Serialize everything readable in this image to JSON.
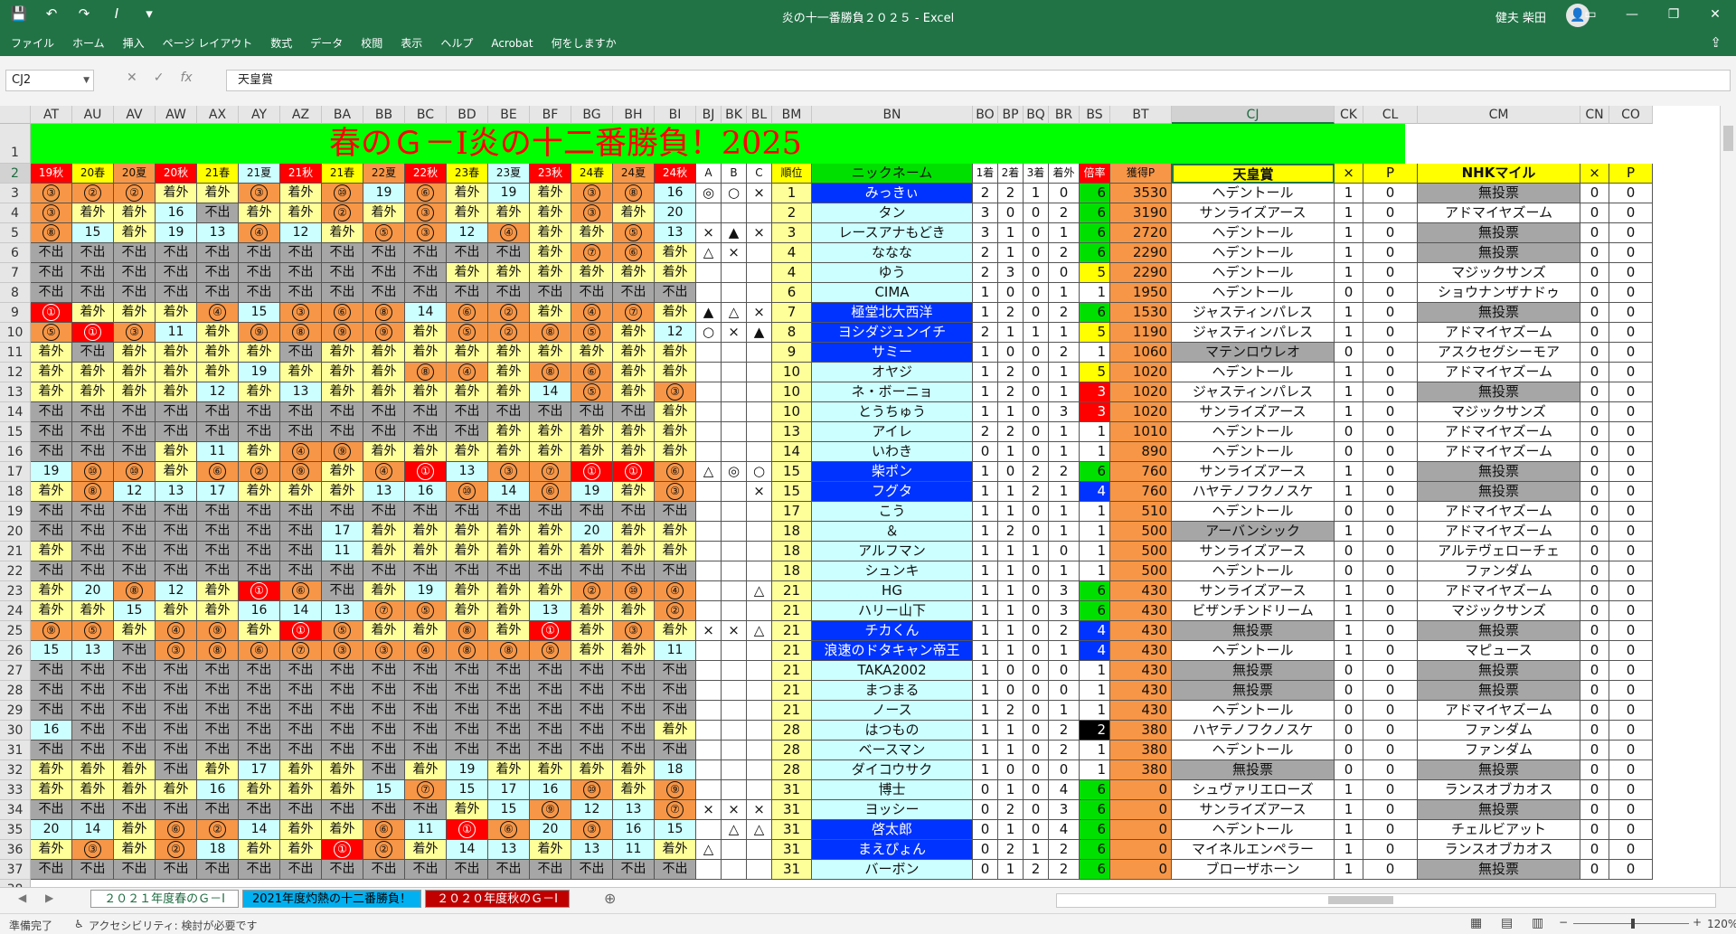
{
  "window": {
    "title": "炎の十一番勝負２０２５ - Excel",
    "user": "健夫 柴田",
    "qat": [
      "save-icon",
      "undo-icon",
      "redo-icon",
      "italic-icon",
      "customize-icon"
    ]
  },
  "ribbon": {
    "tabs": [
      "ファイル",
      "ホーム",
      "挿入",
      "ページ レイアウト",
      "数式",
      "データ",
      "校閲",
      "表示",
      "ヘルプ",
      "Acrobat",
      "何をしますか"
    ]
  },
  "formula_bar": {
    "name_box": "CJ2",
    "fx_label": "fx",
    "content": "天皇賞"
  },
  "sheet": {
    "title": "春のＧ－Ⅰ炎の十二番勝負！2025",
    "columns": [
      "AT",
      "AU",
      "AV",
      "AW",
      "AX",
      "AY",
      "AZ",
      "BA",
      "BB",
      "BC",
      "BD",
      "BE",
      "BF",
      "BG",
      "BH",
      "BI",
      "BJ",
      "BK",
      "BL",
      "BM",
      "BN",
      "BO",
      "BP",
      "BQ",
      "BR",
      "BS",
      "BT",
      "CJ",
      "CK",
      "CL",
      "CM",
      "CN",
      "CO"
    ],
    "row_numbers": [
      "1",
      "2",
      "3",
      "4",
      "5",
      "6",
      "7",
      "8",
      "9",
      "10",
      "11",
      "12",
      "13",
      "14",
      "15",
      "16",
      "17",
      "18",
      "19",
      "20",
      "21",
      "22",
      "23",
      "24",
      "25",
      "26",
      "27",
      "28",
      "29",
      "30",
      "31",
      "32",
      "33",
      "34",
      "35",
      "36",
      "37",
      "38"
    ],
    "header_row": [
      "19秋",
      "20春",
      "20夏",
      "20秋",
      "21春",
      "21夏",
      "21秋",
      "21春",
      "22夏",
      "22秋",
      "23春",
      "23夏",
      "23秋",
      "24春",
      "24夏",
      "24秋",
      "A",
      "B",
      "C",
      "順位",
      "ニックネーム",
      "1着",
      "2着",
      "3着",
      "着外",
      "倍率",
      "獲得P",
      "天皇賞",
      "×",
      "P",
      "NHKマイル",
      "×",
      "P"
    ],
    "rows": [
      [
        "③",
        "②",
        "②",
        "着外",
        "着外",
        "③",
        "着外",
        "⑩",
        "19",
        "⑥",
        "着外",
        "19",
        "着外",
        "③",
        "⑧",
        "16",
        "◎",
        "○",
        "×",
        "1",
        "みっきぃ",
        "2",
        "2",
        "1",
        "0",
        "6",
        "3530",
        "ヘデントール",
        "1",
        "0",
        "無投票",
        "0",
        "0"
      ],
      [
        "③",
        "着外",
        "着外",
        "16",
        "不出",
        "着外",
        "着外",
        "②",
        "着外",
        "③",
        "着外",
        "着外",
        "着外",
        "③",
        "着外",
        "20",
        "",
        "",
        "",
        "2",
        "タン",
        "3",
        "0",
        "0",
        "2",
        "6",
        "3190",
        "サンライズアース",
        "1",
        "0",
        "アドマイヤズーム",
        "0",
        "0"
      ],
      [
        "⑧",
        "15",
        "着外",
        "19",
        "13",
        "④",
        "12",
        "着外",
        "⑤",
        "③",
        "12",
        "④",
        "着外",
        "着外",
        "⑤",
        "13",
        "×",
        "▲",
        "×",
        "3",
        "レースアナもどき",
        "3",
        "1",
        "0",
        "1",
        "6",
        "2720",
        "ヘデントール",
        "1",
        "0",
        "無投票",
        "0",
        "0"
      ],
      [
        "不出",
        "不出",
        "不出",
        "不出",
        "不出",
        "不出",
        "不出",
        "不出",
        "不出",
        "不出",
        "不出",
        "不出",
        "着外",
        "⑦",
        "⑥",
        "着外",
        "△",
        "×",
        "",
        "4",
        "ななな",
        "2",
        "1",
        "0",
        "2",
        "6",
        "2290",
        "ヘデントール",
        "1",
        "0",
        "無投票",
        "0",
        "0"
      ],
      [
        "不出",
        "不出",
        "不出",
        "不出",
        "不出",
        "不出",
        "不出",
        "不出",
        "不出",
        "不出",
        "着外",
        "着外",
        "着外",
        "着外",
        "着外",
        "着外",
        "",
        "",
        "",
        "4",
        "ゆう",
        "2",
        "3",
        "0",
        "0",
        "5",
        "2290",
        "ヘデントール",
        "1",
        "0",
        "マジックサンズ",
        "0",
        "0"
      ],
      [
        "不出",
        "不出",
        "不出",
        "不出",
        "不出",
        "不出",
        "不出",
        "不出",
        "不出",
        "不出",
        "不出",
        "不出",
        "不出",
        "不出",
        "不出",
        "不出",
        "",
        "",
        "",
        "6",
        "CIMA",
        "1",
        "0",
        "0",
        "1",
        "1",
        "1950",
        "ヘデントール",
        "0",
        "0",
        "ショウナンザナドゥ",
        "0",
        "0"
      ],
      [
        "①",
        "着外",
        "着外",
        "着外",
        "④",
        "15",
        "③",
        "⑥",
        "⑧",
        "14",
        "⑥",
        "②",
        "着外",
        "④",
        "⑦",
        "着外",
        "▲",
        "△",
        "×",
        "7",
        "極堂北大西洋",
        "1",
        "2",
        "0",
        "2",
        "6",
        "1530",
        "ジャスティンパレス",
        "1",
        "0",
        "無投票",
        "0",
        "0"
      ],
      [
        "⑤",
        "①",
        "③",
        "11",
        "着外",
        "⑨",
        "⑧",
        "⑨",
        "⑨",
        "着外",
        "⑤",
        "②",
        "⑧",
        "⑤",
        "着外",
        "12",
        "○",
        "×",
        "▲",
        "8",
        "ヨシダジュンイチ",
        "2",
        "1",
        "1",
        "1",
        "5",
        "1190",
        "ジャスティンパレス",
        "1",
        "0",
        "アドマイヤズーム",
        "0",
        "0"
      ],
      [
        "着外",
        "不出",
        "着外",
        "着外",
        "着外",
        "着外",
        "不出",
        "着外",
        "着外",
        "着外",
        "着外",
        "着外",
        "着外",
        "着外",
        "着外",
        "着外",
        "",
        "",
        "",
        "9",
        "サミー",
        "1",
        "0",
        "0",
        "2",
        "1",
        "1060",
        "マテンロウレオ",
        "0",
        "0",
        "アスクセグシーモア",
        "0",
        "0"
      ],
      [
        "着外",
        "着外",
        "着外",
        "着外",
        "着外",
        "19",
        "着外",
        "着外",
        "着外",
        "⑧",
        "④",
        "着外",
        "⑧",
        "⑥",
        "着外",
        "着外",
        "",
        "",
        "",
        "10",
        "オヤジ",
        "1",
        "2",
        "0",
        "1",
        "5",
        "1020",
        "ヘデントール",
        "1",
        "0",
        "アドマイヤズーム",
        "0",
        "0"
      ],
      [
        "着外",
        "着外",
        "着外",
        "着外",
        "12",
        "着外",
        "13",
        "着外",
        "着外",
        "着外",
        "着外",
        "着外",
        "14",
        "⑤",
        "着外",
        "③",
        "",
        "",
        "",
        "10",
        "ネ・ボーニョ",
        "1",
        "2",
        "0",
        "1",
        "3",
        "1020",
        "ジャスティンパレス",
        "1",
        "0",
        "無投票",
        "0",
        "0"
      ],
      [
        "不出",
        "不出",
        "不出",
        "不出",
        "不出",
        "不出",
        "不出",
        "不出",
        "不出",
        "不出",
        "不出",
        "不出",
        "不出",
        "不出",
        "不出",
        "着外",
        "",
        "",
        "",
        "10",
        "とうちゅう",
        "1",
        "1",
        "0",
        "3",
        "3",
        "1020",
        "サンライズアース",
        "1",
        "0",
        "マジックサンズ",
        "0",
        "0"
      ],
      [
        "不出",
        "不出",
        "不出",
        "不出",
        "不出",
        "不出",
        "不出",
        "不出",
        "不出",
        "不出",
        "不出",
        "着外",
        "着外",
        "着外",
        "着外",
        "着外",
        "",
        "",
        "",
        "13",
        "アイレ",
        "2",
        "2",
        "0",
        "1",
        "1",
        "1010",
        "ヘデントール",
        "0",
        "0",
        "アドマイヤズーム",
        "0",
        "0"
      ],
      [
        "不出",
        "不出",
        "不出",
        "着外",
        "11",
        "着外",
        "④",
        "⑨",
        "着外",
        "着外",
        "着外",
        "着外",
        "着外",
        "着外",
        "着外",
        "着外",
        "",
        "",
        "",
        "14",
        "いわき",
        "0",
        "1",
        "0",
        "1",
        "1",
        "890",
        "ヘデントール",
        "0",
        "0",
        "アドマイヤズーム",
        "0",
        "0"
      ],
      [
        "19",
        "⑩",
        "⑩",
        "着外",
        "⑥",
        "②",
        "⑨",
        "着外",
        "④",
        "①",
        "13",
        "③",
        "⑦",
        "①",
        "①",
        "⑥",
        "△",
        "◎",
        "○",
        "15",
        "柴ポン",
        "1",
        "0",
        "2",
        "2",
        "6",
        "760",
        "サンライズアース",
        "1",
        "0",
        "無投票",
        "0",
        "0"
      ],
      [
        "着外",
        "⑧",
        "12",
        "13",
        "17",
        "着外",
        "着外",
        "着外",
        "13",
        "16",
        "⑩",
        "14",
        "⑥",
        "19",
        "着外",
        "③",
        "",
        "",
        "×",
        "15",
        "フグタ",
        "1",
        "1",
        "2",
        "1",
        "4",
        "760",
        "ハヤテノフクノスケ",
        "1",
        "0",
        "無投票",
        "0",
        "0"
      ],
      [
        "不出",
        "不出",
        "不出",
        "不出",
        "不出",
        "不出",
        "不出",
        "不出",
        "不出",
        "不出",
        "不出",
        "不出",
        "不出",
        "不出",
        "不出",
        "不出",
        "",
        "",
        "",
        "17",
        "こう",
        "1",
        "1",
        "0",
        "1",
        "1",
        "510",
        "ヘデントール",
        "0",
        "0",
        "アドマイヤズーム",
        "0",
        "0"
      ],
      [
        "不出",
        "不出",
        "不出",
        "不出",
        "不出",
        "不出",
        "不出",
        "17",
        "着外",
        "着外",
        "着外",
        "着外",
        "着外",
        "20",
        "着外",
        "着外",
        "",
        "",
        "",
        "18",
        "＆",
        "1",
        "2",
        "0",
        "1",
        "1",
        "500",
        "アーバンシック",
        "1",
        "0",
        "アドマイヤズーム",
        "0",
        "0"
      ],
      [
        "着外",
        "不出",
        "不出",
        "不出",
        "不出",
        "不出",
        "不出",
        "11",
        "着外",
        "着外",
        "着外",
        "着外",
        "着外",
        "着外",
        "着外",
        "着外",
        "",
        "",
        "",
        "18",
        "アルフマン",
        "1",
        "1",
        "1",
        "0",
        "1",
        "500",
        "サンライズアース",
        "0",
        "0",
        "アルテヴェローチェ",
        "0",
        "0"
      ],
      [
        "不出",
        "不出",
        "不出",
        "不出",
        "不出",
        "不出",
        "不出",
        "不出",
        "不出",
        "不出",
        "不出",
        "不出",
        "不出",
        "不出",
        "不出",
        "不出",
        "",
        "",
        "",
        "18",
        "シュンキ",
        "1",
        "1",
        "0",
        "1",
        "1",
        "500",
        "ヘデントール",
        "0",
        "0",
        "ファンダム",
        "0",
        "0"
      ],
      [
        "着外",
        "20",
        "⑧",
        "12",
        "着外",
        "①",
        "⑥",
        "不出",
        "着外",
        "19",
        "着外",
        "着外",
        "着外",
        "②",
        "⑩",
        "④",
        "",
        "",
        "△",
        "21",
        "HG",
        "1",
        "1",
        "0",
        "3",
        "6",
        "430",
        "サンライズアース",
        "1",
        "0",
        "アドマイヤズーム",
        "0",
        "0"
      ],
      [
        "着外",
        "着外",
        "15",
        "着外",
        "着外",
        "16",
        "14",
        "13",
        "⑦",
        "⑤",
        "着外",
        "着外",
        "13",
        "着外",
        "着外",
        "②",
        "",
        "",
        "",
        "21",
        "ハリー山下",
        "1",
        "1",
        "0",
        "3",
        "6",
        "430",
        "ビザンチンドリーム",
        "1",
        "0",
        "マジックサンズ",
        "0",
        "0"
      ],
      [
        "⑨",
        "⑤",
        "着外",
        "④",
        "⑨",
        "着外",
        "①",
        "⑤",
        "着外",
        "着外",
        "⑧",
        "着外",
        "①",
        "着外",
        "③",
        "着外",
        "×",
        "×",
        "△",
        "21",
        "チカくん",
        "1",
        "1",
        "0",
        "2",
        "4",
        "430",
        "無投票",
        "1",
        "0",
        "無投票",
        "0",
        "0"
      ],
      [
        "15",
        "13",
        "不出",
        "③",
        "⑧",
        "⑥",
        "⑦",
        "③",
        "③",
        "④",
        "⑧",
        "⑧",
        "⑤",
        "着外",
        "着外",
        "11",
        "",
        "",
        "",
        "21",
        "浪速のドタキャン帝王",
        "1",
        "1",
        "0",
        "1",
        "4",
        "430",
        "ヘデントール",
        "1",
        "0",
        "マピュース",
        "0",
        "0"
      ],
      [
        "不出",
        "不出",
        "不出",
        "不出",
        "不出",
        "不出",
        "不出",
        "不出",
        "不出",
        "不出",
        "不出",
        "不出",
        "不出",
        "不出",
        "不出",
        "不出",
        "",
        "",
        "",
        "21",
        "TAKA2002",
        "1",
        "0",
        "0",
        "0",
        "1",
        "430",
        "無投票",
        "0",
        "0",
        "無投票",
        "0",
        "0"
      ],
      [
        "不出",
        "不出",
        "不出",
        "不出",
        "不出",
        "不出",
        "不出",
        "不出",
        "不出",
        "不出",
        "不出",
        "不出",
        "不出",
        "不出",
        "不出",
        "不出",
        "",
        "",
        "",
        "21",
        "まつまる",
        "1",
        "0",
        "0",
        "0",
        "1",
        "430",
        "無投票",
        "0",
        "0",
        "無投票",
        "0",
        "0"
      ],
      [
        "不出",
        "不出",
        "不出",
        "不出",
        "不出",
        "不出",
        "不出",
        "不出",
        "不出",
        "不出",
        "不出",
        "不出",
        "不出",
        "不出",
        "不出",
        "不出",
        "",
        "",
        "",
        "21",
        "ノース",
        "1",
        "2",
        "0",
        "1",
        "1",
        "430",
        "ヘデントール",
        "0",
        "0",
        "アドマイヤズーム",
        "0",
        "0"
      ],
      [
        "16",
        "不出",
        "不出",
        "不出",
        "不出",
        "不出",
        "不出",
        "不出",
        "不出",
        "不出",
        "不出",
        "不出",
        "不出",
        "不出",
        "不出",
        "着外",
        "",
        "",
        "",
        "28",
        "はつもの",
        "1",
        "1",
        "0",
        "2",
        "2",
        "380",
        "ハヤテノフクノスケ",
        "0",
        "0",
        "ファンダム",
        "0",
        "0"
      ],
      [
        "不出",
        "不出",
        "不出",
        "不出",
        "不出",
        "不出",
        "不出",
        "不出",
        "不出",
        "不出",
        "不出",
        "不出",
        "不出",
        "不出",
        "不出",
        "不出",
        "",
        "",
        "",
        "28",
        "ベースマン",
        "1",
        "1",
        "0",
        "2",
        "1",
        "380",
        "ヘデントール",
        "0",
        "0",
        "ファンダム",
        "0",
        "0"
      ],
      [
        "着外",
        "着外",
        "着外",
        "不出",
        "着外",
        "17",
        "着外",
        "着外",
        "不出",
        "着外",
        "19",
        "着外",
        "着外",
        "着外",
        "着外",
        "18",
        "",
        "",
        "",
        "28",
        "ダイコウサク",
        "1",
        "0",
        "0",
        "0",
        "1",
        "380",
        "無投票",
        "0",
        "0",
        "無投票",
        "0",
        "0"
      ],
      [
        "着外",
        "着外",
        "着外",
        "着外",
        "16",
        "着外",
        "着外",
        "着外",
        "15",
        "⑦",
        "15",
        "17",
        "16",
        "⑩",
        "着外",
        "⑨",
        "",
        "",
        "",
        "31",
        "博士",
        "0",
        "1",
        "0",
        "4",
        "6",
        "0",
        "シュヴァリエローズ",
        "1",
        "0",
        "ランスオブカオス",
        "0",
        "0"
      ],
      [
        "不出",
        "不出",
        "不出",
        "不出",
        "不出",
        "不出",
        "不出",
        "不出",
        "不出",
        "不出",
        "着外",
        "15",
        "⑨",
        "12",
        "13",
        "⑦",
        "×",
        "×",
        "×",
        "31",
        "ヨッシー",
        "0",
        "2",
        "0",
        "3",
        "6",
        "0",
        "サンライズアース",
        "1",
        "0",
        "無投票",
        "0",
        "0"
      ],
      [
        "20",
        "14",
        "着外",
        "⑥",
        "②",
        "14",
        "着外",
        "着外",
        "⑥",
        "11",
        "①",
        "⑥",
        "20",
        "③",
        "16",
        "15",
        "",
        "△",
        "△",
        "31",
        "啓太郎",
        "0",
        "1",
        "0",
        "4",
        "6",
        "0",
        "ヘデントール",
        "1",
        "0",
        "チェルビアット",
        "0",
        "0"
      ],
      [
        "着外",
        "③",
        "着外",
        "②",
        "18",
        "着外",
        "着外",
        "①",
        "②",
        "着外",
        "14",
        "13",
        "着外",
        "13",
        "11",
        "着外",
        "△",
        "",
        "",
        "31",
        "まえぴょん",
        "0",
        "2",
        "1",
        "2",
        "6",
        "0",
        "マイネルエンペラー",
        "1",
        "0",
        "ランスオブカオス",
        "0",
        "0"
      ],
      [
        "不出",
        "不出",
        "不出",
        "不出",
        "不出",
        "不出",
        "不出",
        "不出",
        "不出",
        "不出",
        "不出",
        "不出",
        "不出",
        "不出",
        "不出",
        "不出",
        "",
        "",
        "",
        "31",
        "バーボン",
        "0",
        "1",
        "2",
        "2",
        "6",
        "0",
        "ブローザホーン",
        "1",
        "0",
        "無投票",
        "0",
        "0"
      ]
    ]
  },
  "sheet_tabs": [
    "２０２１年度春のＧ－Ⅰ",
    "2021年度灼熱の十二番勝負！",
    "２０２０年度秋のＧ－Ⅰ"
  ],
  "status": {
    "ready": "準備完了",
    "accessibility": "アクセシビリティ: 検討が必要です",
    "zoom": "120%"
  }
}
